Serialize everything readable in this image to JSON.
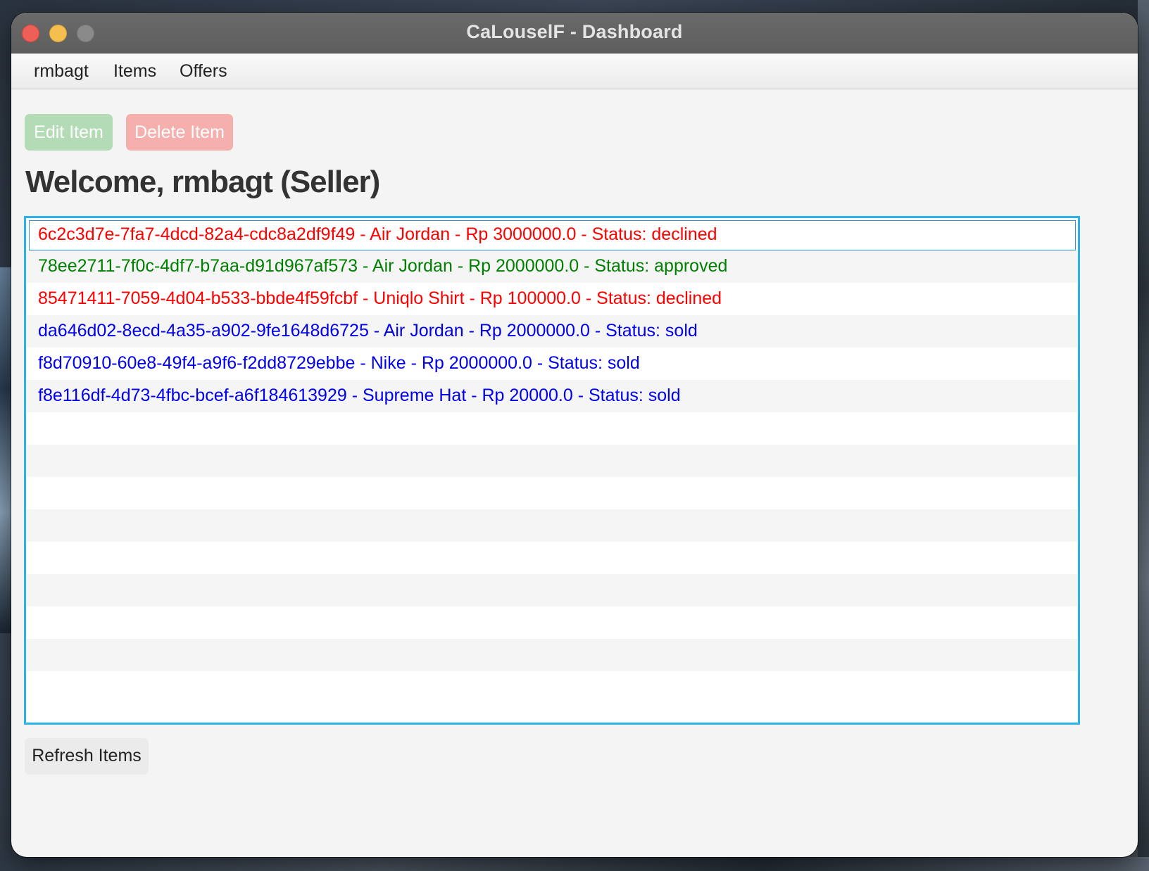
{
  "window": {
    "title": "CaLouselF - Dashboard"
  },
  "menubar": {
    "items": [
      {
        "label": "rmbagt"
      },
      {
        "label": "Items"
      },
      {
        "label": "Offers"
      }
    ]
  },
  "toolbar": {
    "edit_label": "Edit Item",
    "delete_label": "Delete Item"
  },
  "welcome": {
    "text": "Welcome, rmbagt (Seller)"
  },
  "items": [
    {
      "text": "6c2c3d7e-7fa7-4dcd-82a4-cdc8a2df9f49 - Air Jordan - Rp 3000000.0 - Status: declined",
      "status": "declined",
      "color": "#ff0000",
      "selected": true
    },
    {
      "text": "78ee2711-7f0c-4df7-b7aa-d91d967af573 - Air Jordan - Rp 2000000.0 - Status: approved",
      "status": "approved",
      "color": "#008000",
      "selected": false
    },
    {
      "text": "85471411-7059-4d04-b533-bbde4f59fcbf - Uniqlo Shirt - Rp 100000.0 - Status: declined",
      "status": "declined",
      "color": "#ff0000",
      "selected": false
    },
    {
      "text": "da646d02-8ecd-4a35-a902-9fe1648d6725 - Air Jordan - Rp 2000000.0 - Status: sold",
      "status": "sold",
      "color": "#0000ee",
      "selected": false
    },
    {
      "text": "f8d70910-60e8-49f4-a9f6-f2dd8729ebbe - Nike - Rp 2000000.0 - Status: sold",
      "status": "sold",
      "color": "#0000ee",
      "selected": false
    },
    {
      "text": "f8e116df-4d73-4fbc-bcef-a6f184613929 - Supreme Hat - Rp 20000.0 - Status: sold",
      "status": "sold",
      "color": "#0000ee",
      "selected": false
    }
  ],
  "footer": {
    "refresh_label": "Refresh Items"
  },
  "colors": {
    "listbox_focus_border": "#2bb2e6",
    "edit_button": "#b3dcb6",
    "delete_button": "#f5b0ad",
    "close": "#ed5f57",
    "minimize": "#f5bf4f",
    "zoom": "#8a8a8a"
  }
}
